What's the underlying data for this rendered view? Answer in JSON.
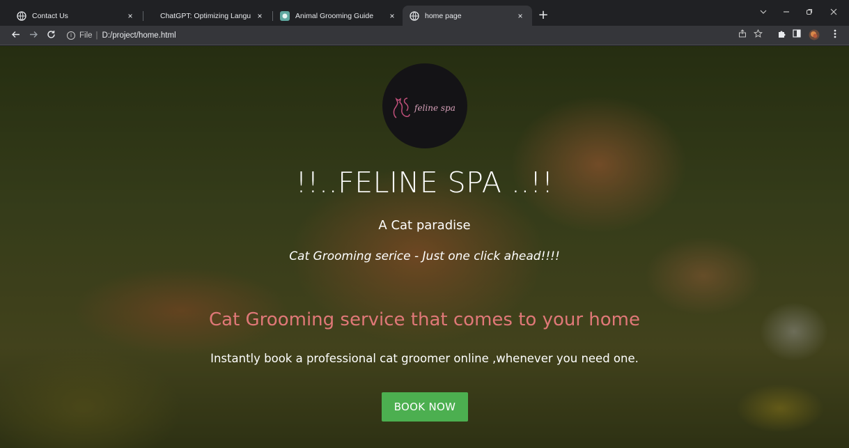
{
  "browser": {
    "tabs": [
      {
        "title": "Contact Us",
        "icon": "globe-icon",
        "active": false
      },
      {
        "title": "ChatGPT: Optimizing Language M",
        "icon": "",
        "active": false
      },
      {
        "title": "Animal Grooming Guide",
        "icon": "grooming-favicon-icon",
        "active": false
      },
      {
        "title": "home page",
        "icon": "globe-icon",
        "active": true
      }
    ],
    "close_symbol": "×",
    "new_tab_symbol": "+",
    "address": {
      "info_symbol": "i",
      "scheme": "File",
      "separator": "|",
      "url": "D:/project/home.html"
    }
  },
  "page": {
    "logo_text": "feline spa",
    "title": "!!..FELINE SPA ..!!",
    "subtitle": "A Cat paradise",
    "tagline": "Cat Grooming serice - Just one click ahead!!!!",
    "service_heading": "Cat Grooming service that comes to your home",
    "description": "Instantly book a professional cat groomer online ,whenever you need one.",
    "cta_label": "BOOK NOW"
  },
  "colors": {
    "accent_pink": "#e07878",
    "cta_green": "#4caf50",
    "logo_bg": "#141316",
    "logo_pink": "#c0507a"
  }
}
